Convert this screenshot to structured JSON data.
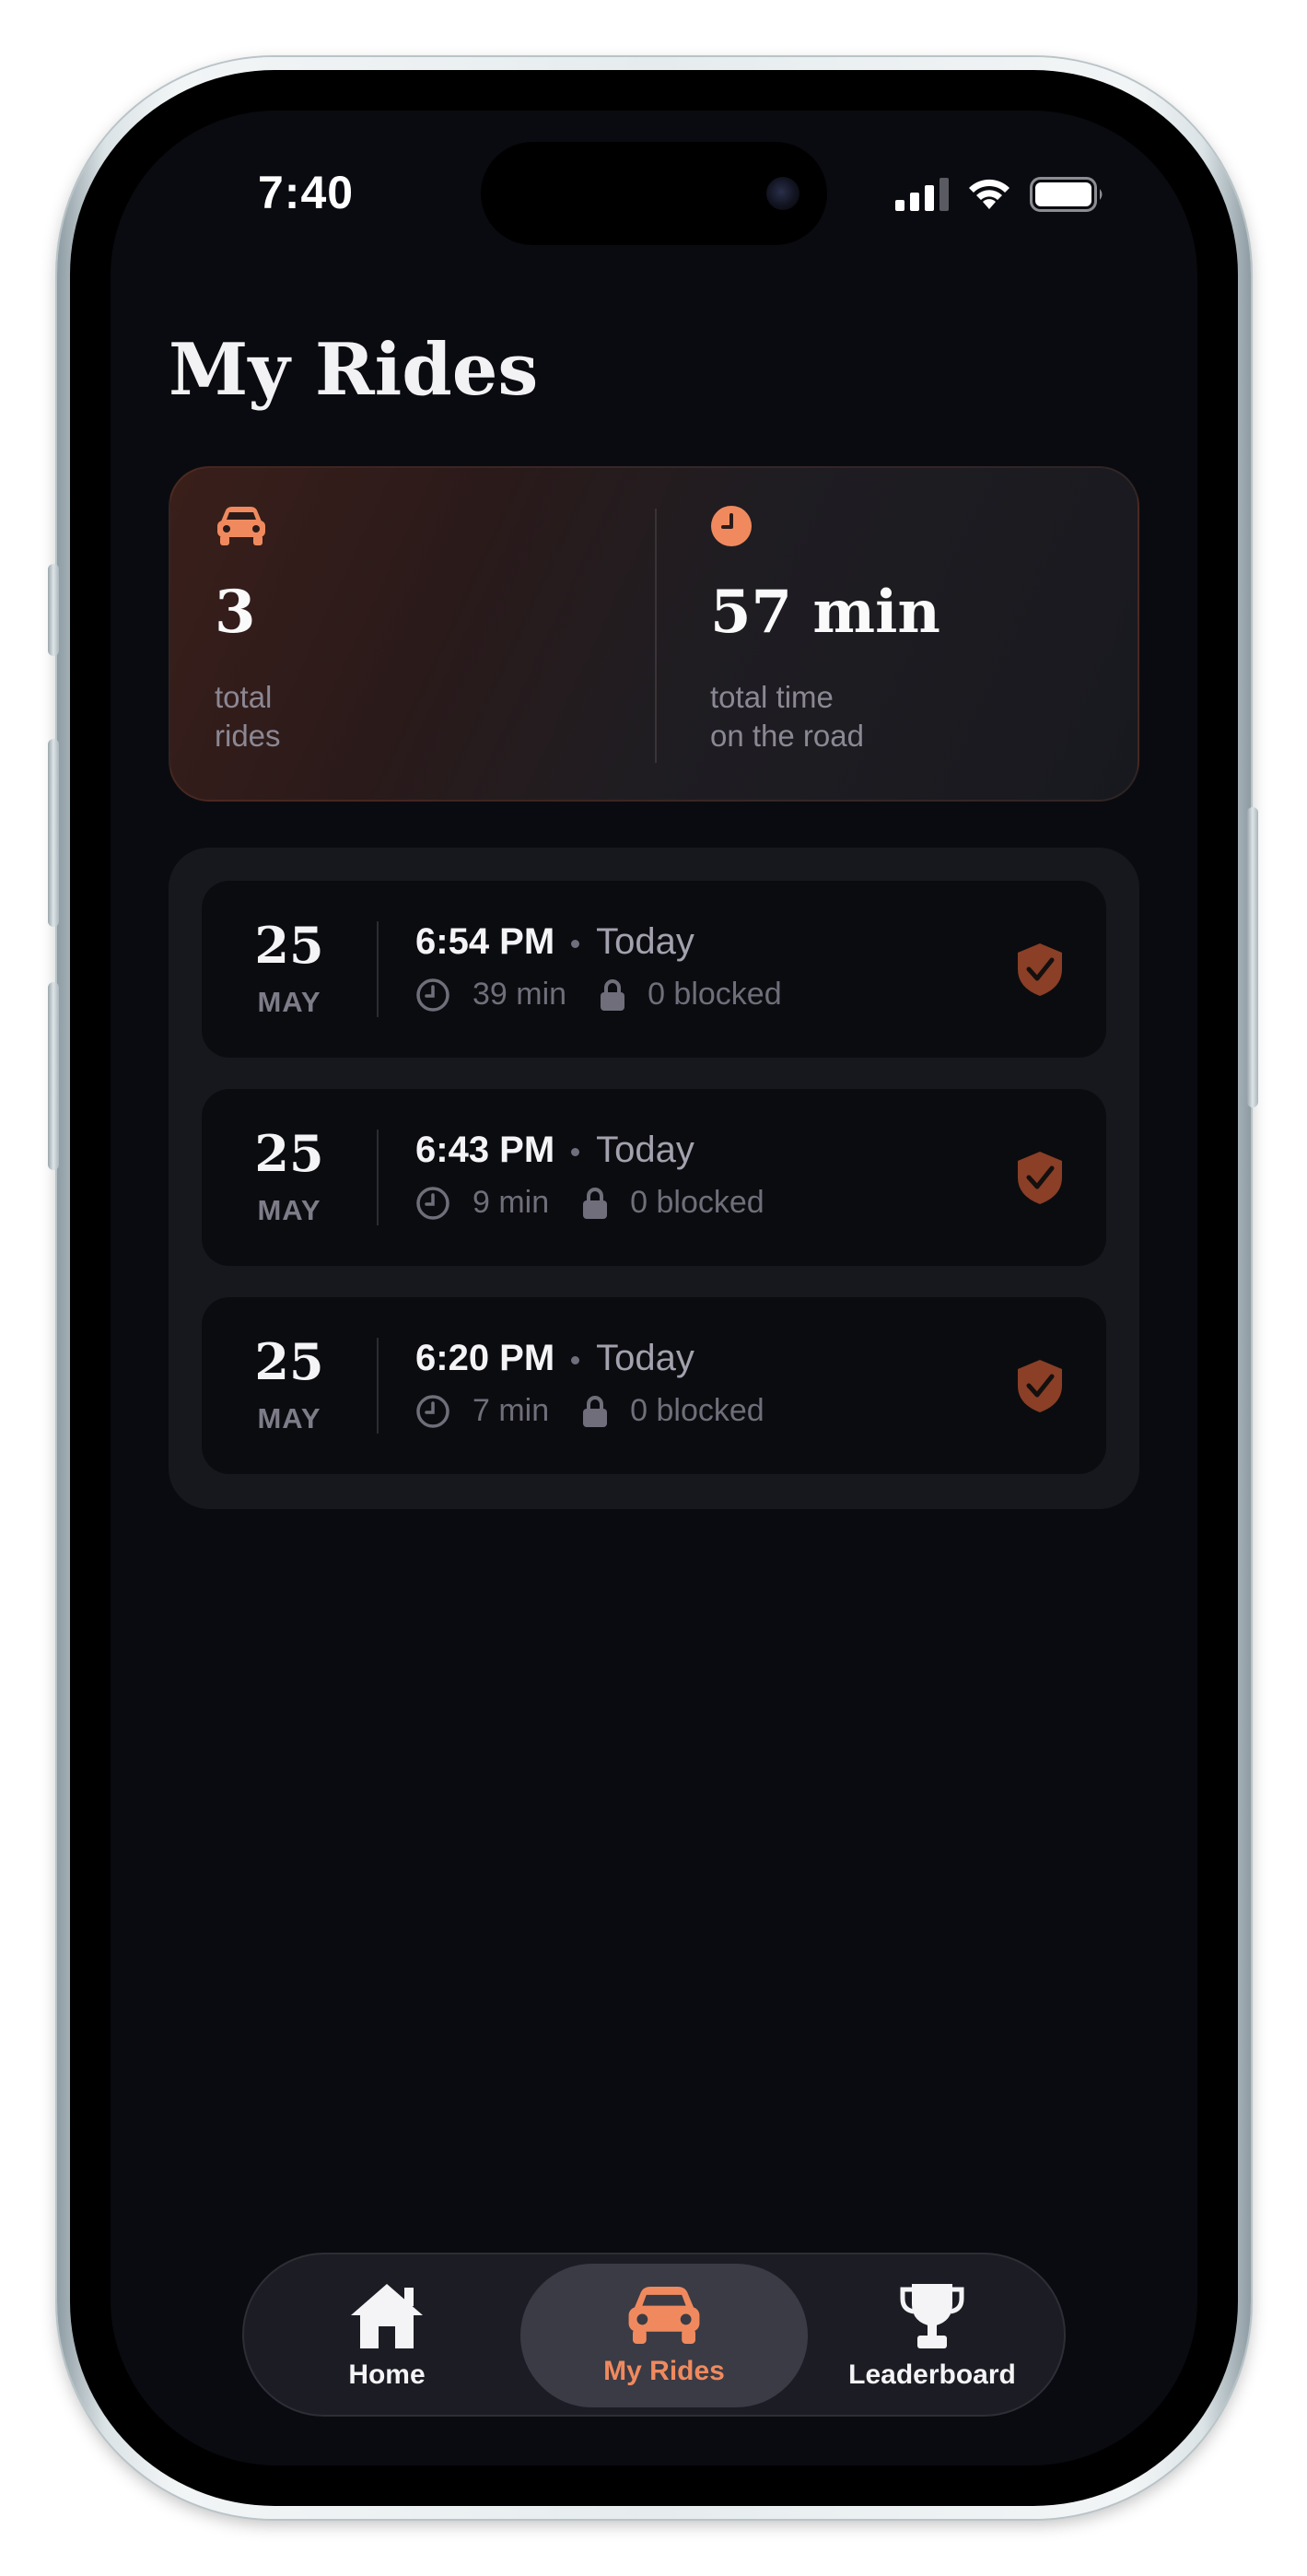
{
  "status_bar": {
    "time": "7:40"
  },
  "page": {
    "title": "My Rides"
  },
  "summary": {
    "rides": {
      "value": "3",
      "label_line1": "total",
      "label_line2": "rides",
      "icon": "car-icon"
    },
    "time": {
      "value": "57 min",
      "label_line1": "total time",
      "label_line2": "on the road",
      "icon": "clock-icon"
    }
  },
  "rides": [
    {
      "day": "25",
      "month": "MAY",
      "time": "6:54 PM",
      "when": "Today",
      "duration": "39 min",
      "blocked": "0 blocked"
    },
    {
      "day": "25",
      "month": "MAY",
      "time": "6:43 PM",
      "when": "Today",
      "duration": "9 min",
      "blocked": "0 blocked"
    },
    {
      "day": "25",
      "month": "MAY",
      "time": "6:20 PM",
      "when": "Today",
      "duration": "7 min",
      "blocked": "0 blocked"
    }
  ],
  "tabs": [
    {
      "label": "Home",
      "icon": "home-icon",
      "active": false
    },
    {
      "label": "My Rides",
      "icon": "car-icon",
      "active": true
    },
    {
      "label": "Leaderboard",
      "icon": "trophy-icon",
      "active": false
    }
  ],
  "colors": {
    "accent": "#f08a5e",
    "shield": "#8a3f26",
    "background": "#0a0b10"
  }
}
